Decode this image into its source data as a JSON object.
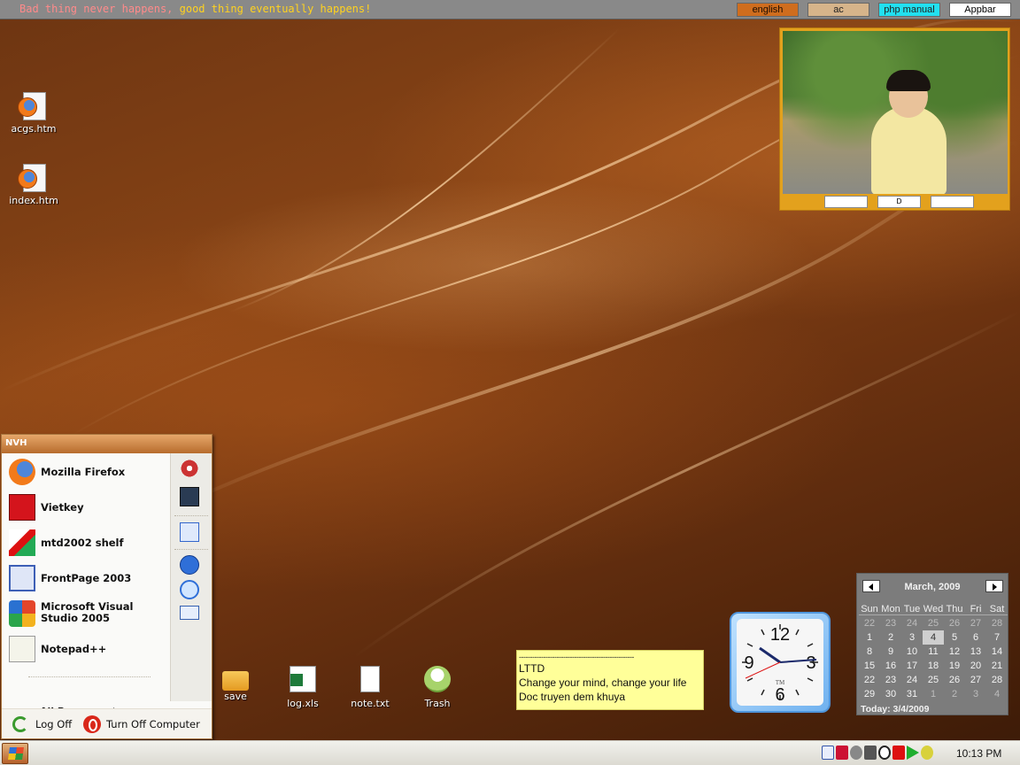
{
  "topbar": {
    "marquee_part1": "Bad thing never happens,",
    "marquee_part2": " good thing eventually happens!",
    "buttons": [
      {
        "label": "english",
        "color": "#cf6d1e"
      },
      {
        "label": "ac",
        "color": "#d6b48a"
      },
      {
        "label": "php manual",
        "color": "#22e0f0"
      },
      {
        "label": "Appbar",
        "color": "#ffffff"
      }
    ]
  },
  "desktop_icons": [
    {
      "label": "acgs.htm",
      "icon": "firefox-html-icon"
    },
    {
      "label": "index.htm",
      "icon": "firefox-html-icon"
    }
  ],
  "photo_widget": {
    "button_label": "D"
  },
  "start_menu": {
    "user": "NVH",
    "pinned": [
      {
        "label": "Mozilla Firefox",
        "icon": "firefox-icon"
      },
      {
        "label": "Vietkey",
        "icon": "vietkey-icon"
      },
      {
        "label": "mtd2002 shelf",
        "icon": "mtd2002-icon"
      },
      {
        "label": "FrontPage 2003",
        "icon": "frontpage-icon"
      },
      {
        "label": "Microsoft Visual Studio 2005",
        "icon": "visual-studio-icon"
      },
      {
        "label": "Notepad++",
        "icon": "notepadpp-icon"
      }
    ],
    "all_programs": "All Programs",
    "log_off": "Log Off",
    "turn_off": "Turn Off Computer"
  },
  "shelf_icons": [
    {
      "label": "save",
      "icon": "folder-icon"
    },
    {
      "label": "log.xls",
      "icon": "excel-file-icon"
    },
    {
      "label": "note.txt",
      "icon": "text-file-icon"
    },
    {
      "label": "Trash",
      "icon": "trash-icon"
    }
  ],
  "note": {
    "separator": "----------------------------------------------------",
    "line1": "LTTD",
    "line2": "Change your mind, change your life",
    "line3": "Doc truyen dem khuya"
  },
  "clock_widget": {
    "numerals": [
      "12",
      "3",
      "6",
      "9"
    ],
    "brand": "TM"
  },
  "calendar": {
    "title": "March, 2009",
    "weekdays": [
      "Sun",
      "Mon",
      "Tue",
      "Wed",
      "Thu",
      "Fri",
      "Sat"
    ],
    "weeks": [
      [
        "22",
        "23",
        "24",
        "25",
        "26",
        "27",
        "28"
      ],
      [
        "1",
        "2",
        "3",
        "4",
        "5",
        "6",
        "7"
      ],
      [
        "8",
        "9",
        "10",
        "11",
        "12",
        "13",
        "14"
      ],
      [
        "15",
        "16",
        "17",
        "18",
        "19",
        "20",
        "21"
      ],
      [
        "22",
        "23",
        "24",
        "25",
        "26",
        "27",
        "28"
      ],
      [
        "29",
        "30",
        "31",
        "1",
        "2",
        "3",
        "4"
      ]
    ],
    "today_label": "Today: 3/4/2009",
    "selected_day": "4"
  },
  "taskbar": {
    "time": "10:13 PM",
    "tray_icons": [
      "keyboard-icon",
      "mtd-icon",
      "media-icon",
      "speaker-icon",
      "clock-tray-icon",
      "k-icon",
      "play-icon",
      "refresh-icon"
    ]
  }
}
